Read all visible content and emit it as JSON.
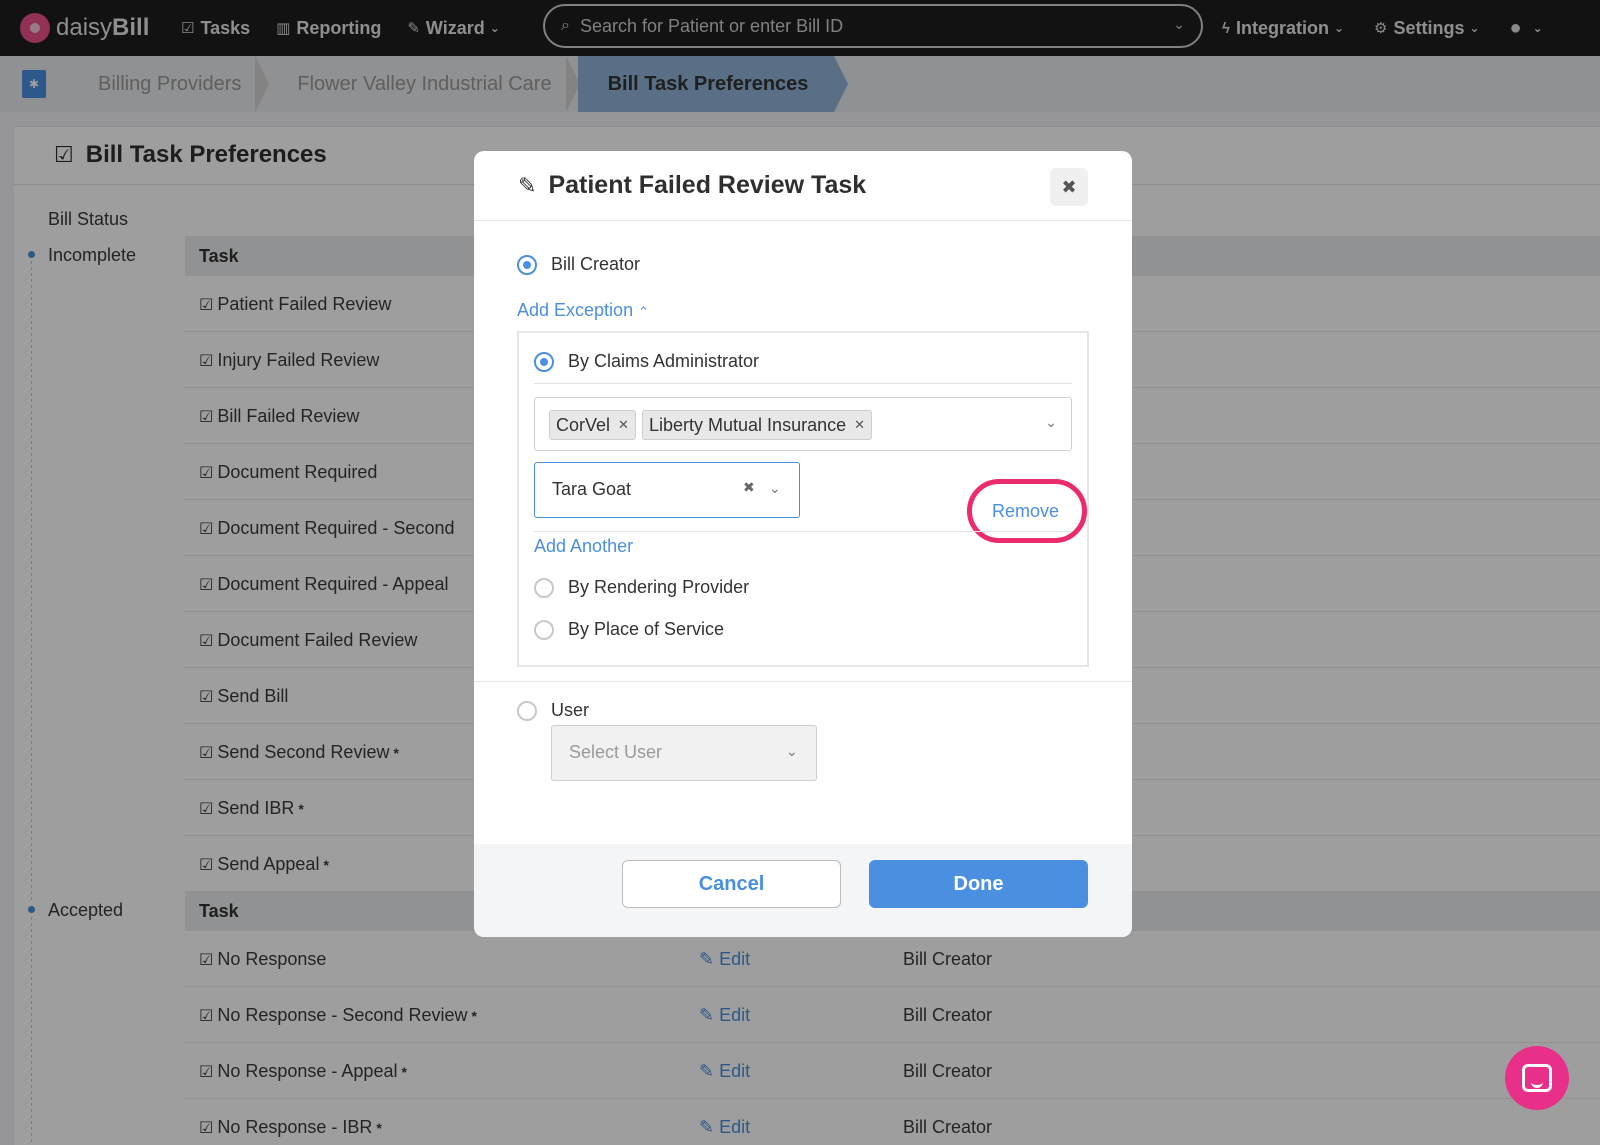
{
  "nav": {
    "brand_light": "daisy",
    "brand_bold": "Bill",
    "tasks": "Tasks",
    "reporting": "Reporting",
    "wizard": "Wizard",
    "search_placeholder": "Search for Patient or enter Bill ID",
    "integration": "Integration",
    "settings": "Settings"
  },
  "breadcrumb": {
    "items": [
      "Billing Providers",
      "Flower Valley Industrial Care",
      "Bill Task Preferences"
    ]
  },
  "page": {
    "title": "Bill Task Preferences",
    "bill_status_label": "Bill Status",
    "incomplete": {
      "label": "Incomplete",
      "column": "Task",
      "tasks": [
        {
          "name": "Patient Failed Review",
          "mark": ""
        },
        {
          "name": "Injury Failed Review",
          "mark": ""
        },
        {
          "name": "Bill Failed Review",
          "mark": ""
        },
        {
          "name": "Document Required",
          "mark": ""
        },
        {
          "name": "Document Required - Second",
          "mark": ""
        },
        {
          "name": "Document Required - Appeal",
          "mark": ""
        },
        {
          "name": "Document Failed Review",
          "mark": ""
        },
        {
          "name": "Send Bill",
          "mark": ""
        },
        {
          "name": "Send Second Review",
          "mark": "*"
        },
        {
          "name": "Send IBR",
          "mark": "*"
        },
        {
          "name": "Send Appeal",
          "mark": "*"
        }
      ]
    },
    "accepted": {
      "label": "Accepted",
      "column": "Task",
      "tasks": [
        {
          "name": "No Response",
          "mark": "",
          "edit": "Edit",
          "assignee": "Bill Creator"
        },
        {
          "name": "No Response - Second Review",
          "mark": "*",
          "edit": "Edit",
          "assignee": "Bill Creator"
        },
        {
          "name": "No Response - Appeal",
          "mark": "*",
          "edit": "Edit",
          "assignee": "Bill Creator"
        },
        {
          "name": "No Response - IBR",
          "mark": "*",
          "edit": "Edit",
          "assignee": "Bill Creator"
        }
      ]
    }
  },
  "modal": {
    "title": "Patient Failed Review Task",
    "bill_creator": "Bill Creator",
    "add_exception": "Add Exception",
    "by_claims_admin": "By Claims Administrator",
    "chips": [
      "CorVel",
      "Liberty Mutual Insurance"
    ],
    "assignee_value": "Tara Goat",
    "remove": "Remove",
    "add_another": "Add Another",
    "by_rendering_provider": "By Rendering Provider",
    "by_place_of_service": "By Place of Service",
    "user": "User",
    "select_user_placeholder": "Select User",
    "cancel": "Cancel",
    "done": "Done"
  },
  "colors": {
    "accent": "#4a8fe0",
    "highlight": "#ec2b6c",
    "nav_bg": "#1e1e1e"
  }
}
